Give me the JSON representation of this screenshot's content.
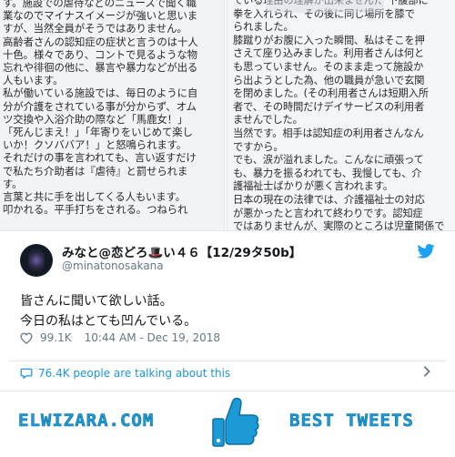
{
  "photo": {
    "left_page_lines": [
      "す。施設での虐待などのニュースで聞く職",
      "業なのでマイナスイメージが強いと思いま",
      "すが、当然全員がそうではありません。",
      "高齢者さんの認知症の症状と言うのは十人",
      "十色。様々であり、コントで見るような物",
      "忘れや徘徊の他に、暴言や暴力などが出る",
      "人もいます。",
      "私が働いている施設では、毎日のように自",
      "分が介護をされている事が分からず、オム",
      "ツ交換や入浴介助の際など「馬鹿女！」",
      "「死んじまえ！」「年寄りをいじめて楽し",
      "いか！クソババア！」と怒鳴られます。",
      "それだけの事を言われても、言い返すだけ",
      "で私たち介助者は『虐待』と罰せられま",
      "す。",
      "言葉と共に手を出してくる人もいます。",
      "叩かれる。平手打ちをされる。つねられ"
    ],
    "right_page_lines": [
      "ている理由の理解が出来ません)、下腹部に",
      "拳を入れられ、その後に同じ場所を膝で",
      "られました。",
      "膝蹴りがお腹に入った瞬間、私はそこを押",
      "さえて座り込みました。利用者さんは何と",
      "も思っていません。そのまま走って施設か",
      "ら出ようとした為、他の職員が急いで玄関",
      "を閉めました。(その利用者さんは短期入所",
      "者で、その時間だけデイサービスの利用者",
      "ませんでした。",
      "当然です。相手は認知症の利用者さんなん",
      "ですから。",
      "でも、涙が溢れました。こんなに頑張って",
      "も、暴力を振るわれても、我慢しても、介",
      "護福祉士ばかりが悪く言われます。",
      "日本の現在の法律では、介護福祉士の対応",
      "が悪かったと言われて終わりです。認知症",
      "ではありませんが、実際のところは児童関係で"
    ]
  },
  "tweet": {
    "display_name": "みなと@恋どろ🎩い４６【12/29タ50b】",
    "handle": "@minatonosakana",
    "text_lines": [
      "皆さんに聞いて欲しい話。",
      "今日の私はとても凹んでいる。"
    ],
    "likes": "99.1K",
    "timestamp": "10:44 AM - Dec 19, 2018",
    "talking": "76.4K people are talking about this",
    "icons": {
      "bird": "twitter-bird-icon",
      "heart": "heart-icon",
      "talk": "speech-bubble-icon",
      "chevron": "chevron-right-icon"
    },
    "colors": {
      "link": "#1b95e0",
      "twitter": "#1da1f2",
      "muted": "#657786"
    }
  },
  "banner": {
    "brand": "ELWIZARA.COM",
    "best": "BEST TWEETS",
    "icon": "thumbs-up-icon",
    "color": "#1c9ad6"
  }
}
